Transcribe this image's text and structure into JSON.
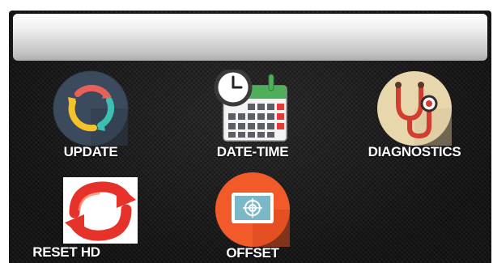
{
  "screen": {
    "title_bar_text": ""
  },
  "tiles": [
    {
      "id": "update",
      "label": "UPDATE",
      "icon": "update-sync-icon"
    },
    {
      "id": "date-time",
      "label": "DATE-TIME",
      "icon": "clock-calendar-icon"
    },
    {
      "id": "diagnostics",
      "label": "DIAGNOSTICS",
      "icon": "stethoscope-icon"
    },
    {
      "id": "reset-hd",
      "label": "RESET HD",
      "icon": "reset-arrows-icon"
    },
    {
      "id": "offset",
      "label": "OFFSET",
      "icon": "crosshair-screen-icon"
    }
  ],
  "colors": {
    "panel_background": "#1a1a1a",
    "label_text": "#ffffff",
    "update_circle": "#3b4a5c",
    "update_ring_red": "#e8605a",
    "update_ring_yellow": "#f4c22b",
    "update_ring_teal": "#3cbfb1",
    "calendar_header": "#4fae5a",
    "calendar_accent": "#e53935",
    "diagnostics_circle": "#e8d6ad",
    "stethoscope_red": "#d33c2e",
    "reset_red": "#e6322b",
    "offset_circle": "#f25a2a",
    "offset_screen": "#7ab8c9"
  }
}
